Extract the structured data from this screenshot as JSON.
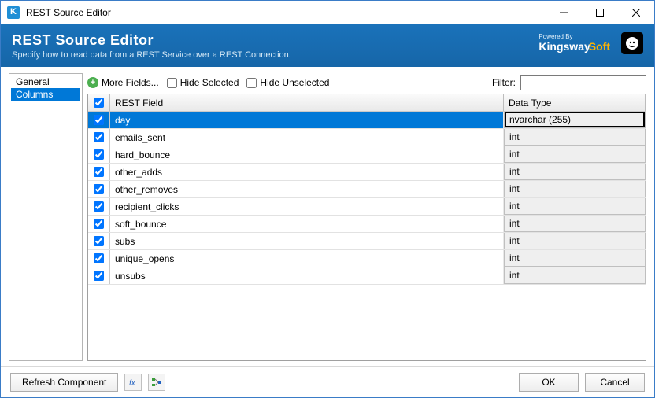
{
  "window_title": "REST Source Editor",
  "banner": {
    "title": "REST Source Editor",
    "subtitle": "Specify how to read data from a REST Service over a REST Connection.",
    "powered_by": "Powered By",
    "brand1": "Kingsway",
    "brand2": "Soft"
  },
  "sidebar": {
    "items": [
      "General",
      "Columns"
    ],
    "selected_index": 1
  },
  "toolbar": {
    "more_fields": "More Fields...",
    "hide_selected": "Hide Selected",
    "hide_unselected": "Hide Unselected",
    "filter_label": "Filter:",
    "filter_value": ""
  },
  "grid": {
    "headers": {
      "field": "REST Field",
      "type": "Data Type"
    },
    "rows": [
      {
        "field": "day",
        "type": "nvarchar (255)",
        "checked": true,
        "selected": true
      },
      {
        "field": "emails_sent",
        "type": "int",
        "checked": true,
        "selected": false
      },
      {
        "field": "hard_bounce",
        "type": "int",
        "checked": true,
        "selected": false
      },
      {
        "field": "other_adds",
        "type": "int",
        "checked": true,
        "selected": false
      },
      {
        "field": "other_removes",
        "type": "int",
        "checked": true,
        "selected": false
      },
      {
        "field": "recipient_clicks",
        "type": "int",
        "checked": true,
        "selected": false
      },
      {
        "field": "soft_bounce",
        "type": "int",
        "checked": true,
        "selected": false
      },
      {
        "field": "subs",
        "type": "int",
        "checked": true,
        "selected": false
      },
      {
        "field": "unique_opens",
        "type": "int",
        "checked": true,
        "selected": false
      },
      {
        "field": "unsubs",
        "type": "int",
        "checked": true,
        "selected": false
      }
    ]
  },
  "footer": {
    "refresh": "Refresh Component",
    "ok": "OK",
    "cancel": "Cancel"
  }
}
